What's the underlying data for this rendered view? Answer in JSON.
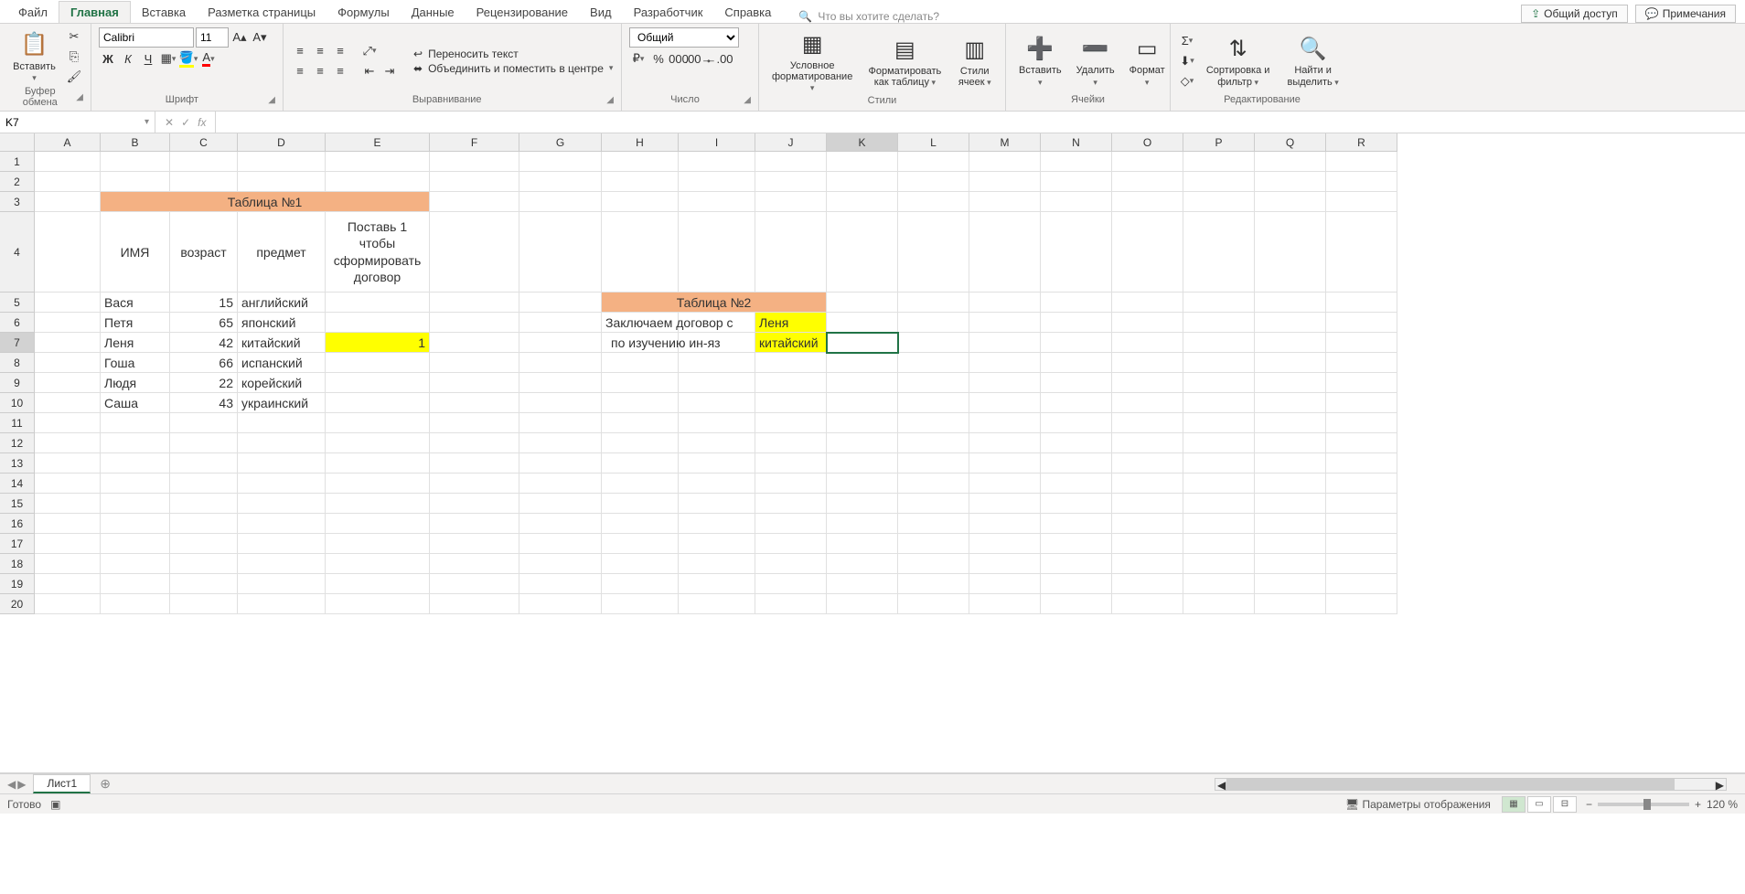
{
  "tabs": {
    "items": [
      "Файл",
      "Главная",
      "Вставка",
      "Разметка страницы",
      "Формулы",
      "Данные",
      "Рецензирование",
      "Вид",
      "Разработчик",
      "Справка"
    ],
    "active": "Главная",
    "tell_me_placeholder": "Что вы хотите сделать?"
  },
  "right": {
    "share": "Общий доступ",
    "comments": "Примечания"
  },
  "ribbon": {
    "clipboard": {
      "paste": "Вставить",
      "label": "Буфер обмена"
    },
    "font": {
      "name": "Calibri",
      "size": "11",
      "label": "Шрифт",
      "bold": "Ж",
      "italic": "К",
      "underline": "Ч"
    },
    "align": {
      "wrap": "Переносить текст",
      "merge": "Объединить и поместить в центре",
      "label": "Выравнивание"
    },
    "number": {
      "format": "Общий",
      "label": "Число"
    },
    "styles": {
      "cond": "Условное форматирование",
      "table": "Форматировать как таблицу",
      "cell": "Стили ячеек",
      "label": "Стили"
    },
    "cells": {
      "insert": "Вставить",
      "delete": "Удалить",
      "format": "Формат",
      "label": "Ячейки"
    },
    "editing": {
      "sort": "Сортировка и фильтр",
      "find": "Найти и выделить",
      "label": "Редактирование"
    }
  },
  "namebox": "K7",
  "formula": "",
  "columns": [
    "A",
    "B",
    "C",
    "D",
    "E",
    "F",
    "G",
    "H",
    "I",
    "J",
    "K",
    "L",
    "M",
    "N",
    "O",
    "P",
    "Q",
    "R"
  ],
  "col_widths": {
    "A": 72,
    "B": 76,
    "C": 74,
    "D": 96,
    "E": 114,
    "F": 98,
    "G": 90,
    "H": 84,
    "I": 84,
    "J": 78,
    "K": 78,
    "L": 78,
    "M": 78,
    "N": 78,
    "O": 78,
    "P": 78,
    "Q": 78,
    "R": 78
  },
  "selected_col": "K",
  "selected_row": 7,
  "sheet": {
    "table1_title": "Таблица №1",
    "headers": [
      "ИМЯ",
      "возраст",
      "предмет",
      "Поставь 1 чтобы сформировать договор"
    ],
    "rows": [
      {
        "r": 5,
        "name": "Вася",
        "age": 15,
        "subj": "английский",
        "mark": ""
      },
      {
        "r": 6,
        "name": "Петя",
        "age": 65,
        "subj": "японский",
        "mark": ""
      },
      {
        "r": 7,
        "name": "Леня",
        "age": 42,
        "subj": "китайский",
        "mark": "1"
      },
      {
        "r": 8,
        "name": "Гоша",
        "age": 66,
        "subj": "испанский",
        "mark": ""
      },
      {
        "r": 9,
        "name": "Людя",
        "age": 22,
        "subj": "корейский",
        "mark": ""
      },
      {
        "r": 10,
        "name": "Саша",
        "age": 43,
        "subj": "украинский",
        "mark": ""
      }
    ],
    "table2_title": "Таблица №2",
    "t2_line1": "Заключаем договор с",
    "t2_line2": "по изучению ин-яз",
    "t2_val1": "Леня",
    "t2_val2": "китайский"
  },
  "sheet_tab": "Лист1",
  "status": {
    "ready": "Готово",
    "display": "Параметры отображения",
    "zoom": "120 %"
  }
}
